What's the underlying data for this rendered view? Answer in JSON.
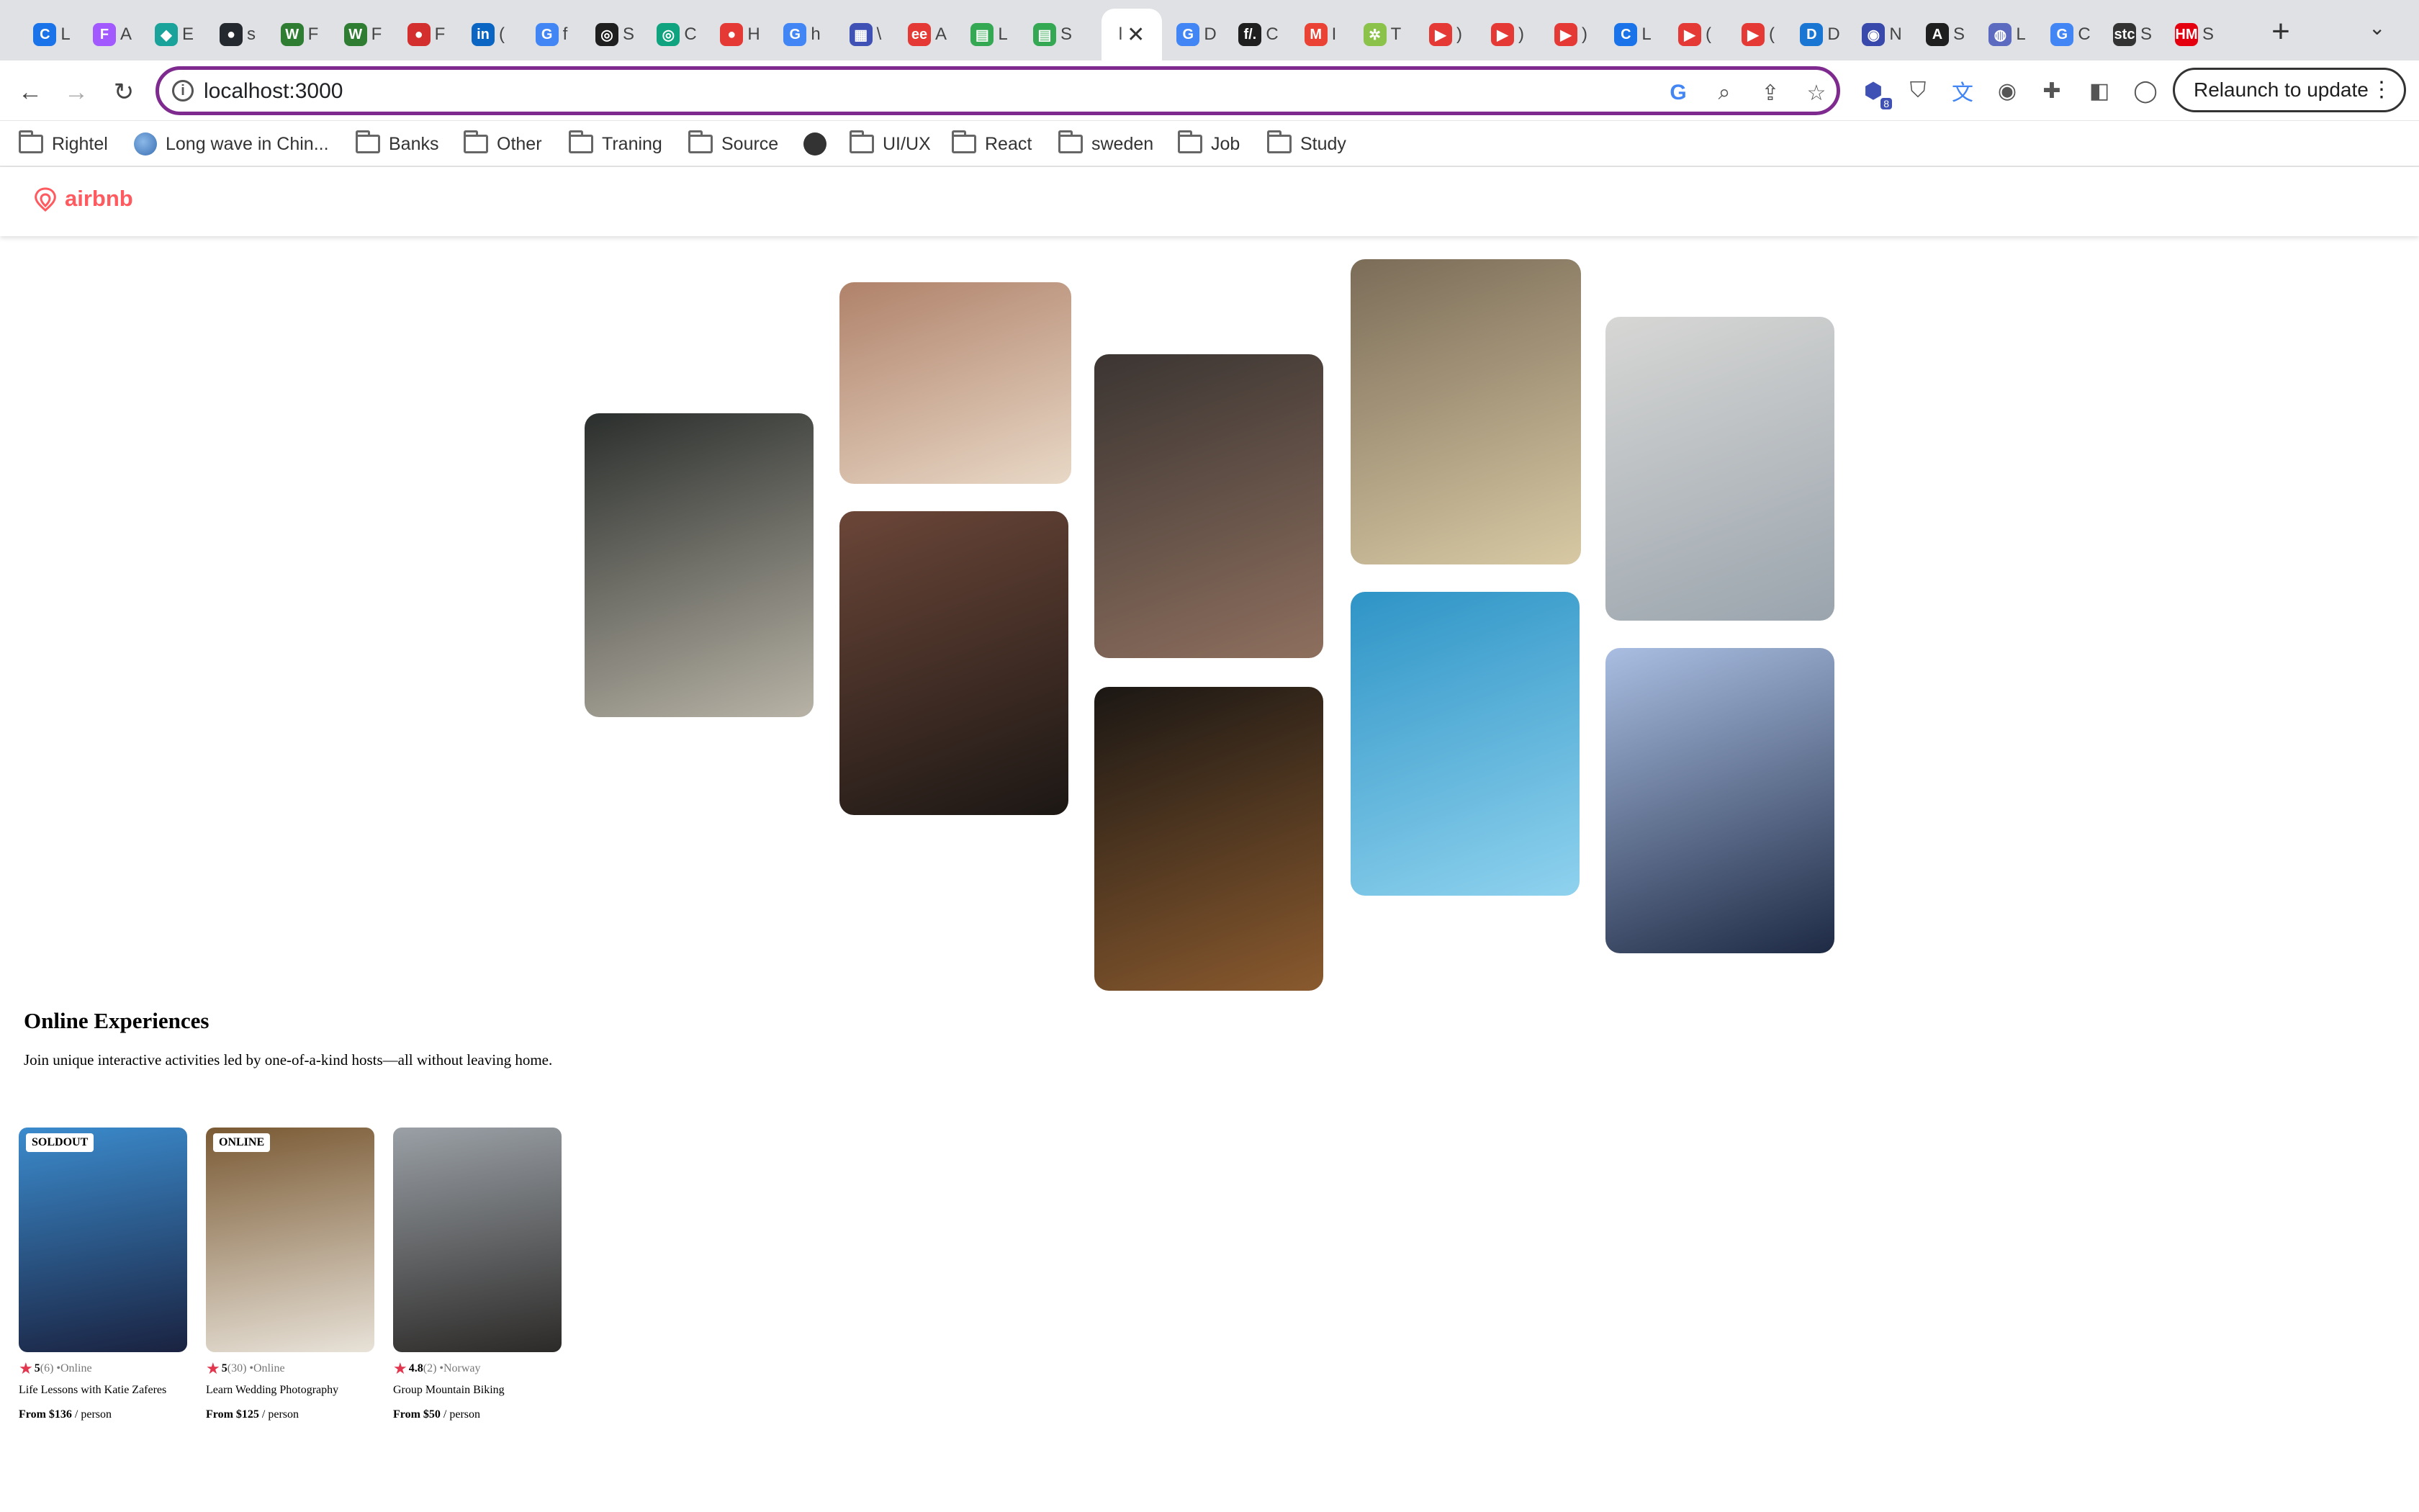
{
  "browser": {
    "url": "localhost:3000",
    "relaunch_label": "Relaunch to update",
    "extension_badge": "8",
    "active_tab_letter": "l",
    "tabs": [
      {
        "letter": "L",
        "color": "#1a73e8",
        "glyph": "C"
      },
      {
        "letter": "A",
        "color": "#a259ff",
        "glyph": "F"
      },
      {
        "letter": "E",
        "color": "#1aa39a",
        "glyph": "◆"
      },
      {
        "letter": "s",
        "color": "#24292f",
        "glyph": "●"
      },
      {
        "letter": "F",
        "color": "#2e7d32",
        "glyph": "W"
      },
      {
        "letter": "F",
        "color": "#2e7d32",
        "glyph": "W"
      },
      {
        "letter": "F",
        "color": "#d32f2f",
        "glyph": "●"
      },
      {
        "letter": "(",
        "color": "#0a66c2",
        "glyph": "in"
      },
      {
        "letter": "f",
        "color": "#4285f4",
        "glyph": "G"
      },
      {
        "letter": "S",
        "color": "#1f1f1f",
        "glyph": "◎"
      },
      {
        "letter": "C",
        "color": "#10a37f",
        "glyph": "◎"
      },
      {
        "letter": "H",
        "color": "#e53935",
        "glyph": "●"
      },
      {
        "letter": "h",
        "color": "#4285f4",
        "glyph": "G"
      },
      {
        "letter": "\\",
        "color": "#3f51b5",
        "glyph": "▦"
      },
      {
        "letter": "A",
        "color": "#e53935",
        "glyph": "ee"
      },
      {
        "letter": "L",
        "color": "#34a853",
        "glyph": "▤"
      },
      {
        "letter": "S",
        "color": "#34a853",
        "glyph": "▤"
      },
      {
        "letter": "D",
        "color": "#4285f4",
        "glyph": "G"
      },
      {
        "letter": "C",
        "color": "#1f1f1f",
        "glyph": "f/."
      },
      {
        "letter": "I",
        "color": "#ea4335",
        "glyph": "M"
      },
      {
        "letter": "T",
        "color": "#8bc34a",
        "glyph": "✲"
      },
      {
        "letter": ")",
        "color": "#e53935",
        "glyph": "▶"
      },
      {
        "letter": ")",
        "color": "#e53935",
        "glyph": "▶"
      },
      {
        "letter": ")",
        "color": "#e53935",
        "glyph": "▶"
      },
      {
        "letter": "L",
        "color": "#1a73e8",
        "glyph": "C"
      },
      {
        "letter": "(",
        "color": "#e53935",
        "glyph": "▶"
      },
      {
        "letter": "(",
        "color": "#e53935",
        "glyph": "▶"
      },
      {
        "letter": "D",
        "color": "#1976d2",
        "glyph": "D"
      },
      {
        "letter": "N",
        "color": "#3949ab",
        "glyph": "◉"
      },
      {
        "letter": "S",
        "color": "#1f1f1f",
        "glyph": "A"
      },
      {
        "letter": "L",
        "color": "#5c6bc0",
        "glyph": "◍"
      },
      {
        "letter": "C",
        "color": "#4285f4",
        "glyph": "G"
      },
      {
        "letter": "S",
        "color": "#333333",
        "glyph": "stc"
      },
      {
        "letter": "S",
        "color": "#e50010",
        "glyph": "HM"
      }
    ]
  },
  "bookmarks": [
    {
      "label": "Rightel",
      "icon": "folder-icon"
    },
    {
      "label": "Long wave in Chin...",
      "icon": "globe-icon"
    },
    {
      "label": "Banks",
      "icon": "folder-icon"
    },
    {
      "label": "Other",
      "icon": "folder-icon"
    },
    {
      "label": "Traning",
      "icon": "folder-icon"
    },
    {
      "label": "Source",
      "icon": "folder-icon"
    },
    {
      "label": "",
      "icon": "world-icon"
    },
    {
      "label": "UI/UX",
      "icon": "folder-icon"
    },
    {
      "label": "React",
      "icon": "folder-icon"
    },
    {
      "label": "sweden",
      "icon": "folder-icon"
    },
    {
      "label": "Job",
      "icon": "folder-icon"
    },
    {
      "label": "Study",
      "icon": "folder-icon"
    }
  ],
  "site": {
    "brand": "airbnb",
    "brand_color": "#ff5a5f",
    "gallery": [
      {
        "subject": "cooking-pan",
        "colors": [
          "#2a2e2c",
          "#b8b3a6"
        ]
      },
      {
        "subject": "macarons-baker",
        "colors": [
          "#b0826a",
          "#e8d8c6"
        ]
      },
      {
        "subject": "ballet-doorway",
        "colors": [
          "#6b4638",
          "#1c1714"
        ]
      },
      {
        "subject": "food-bowl",
        "colors": [
          "#3b3532",
          "#8e6f5e"
        ]
      },
      {
        "subject": "acoustic-guitar",
        "colors": [
          "#1b1714",
          "#8a5a2e"
        ]
      },
      {
        "subject": "piano-microphone",
        "colors": [
          "#7b6c58",
          "#d8c9a4"
        ]
      },
      {
        "subject": "swimmer-pool",
        "colors": [
          "#2e94c6",
          "#8fd2ee"
        ]
      },
      {
        "subject": "yoga-meditation",
        "colors": [
          "#d7d7d5",
          "#9aa4ad"
        ]
      },
      {
        "subject": "singer-microphone",
        "colors": [
          "#a9bee2",
          "#1e2a44"
        ]
      }
    ],
    "section": {
      "title": "Online Experiences",
      "subtitle": "Join unique interactive activities led by one-of-a-kind hosts—all without leaving home."
    },
    "cards": [
      {
        "badge": "SOLDOUT",
        "rating": "5",
        "reviews": "(6)",
        "location": "•Online",
        "title": "Life Lessons with Katie Zaferes",
        "price": "From $136",
        "unit": " / person",
        "colors": [
          "#3b8bcd",
          "#1a2240"
        ]
      },
      {
        "badge": "ONLINE",
        "rating": "5",
        "reviews": "(30)",
        "location": "•Online",
        "title": "Learn Wedding Photography",
        "price": "From $125",
        "unit": " / person",
        "colors": [
          "#7a5a34",
          "#e8e2d8"
        ]
      },
      {
        "badge": "",
        "rating": "4.8",
        "reviews": "(2)",
        "location": "•Norway",
        "title": "Group Mountain Biking",
        "price": "From $50",
        "unit": " / person",
        "colors": [
          "#9aa0a6",
          "#2c2a28"
        ]
      }
    ]
  }
}
